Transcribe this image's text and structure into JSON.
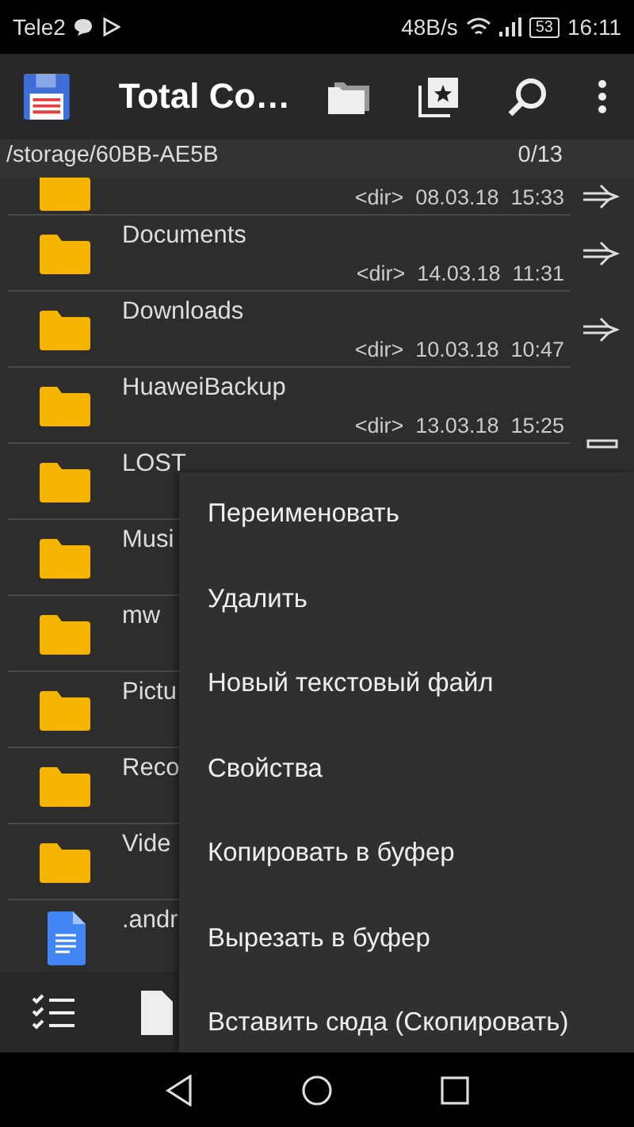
{
  "status_bar": {
    "carrier": "Tele2",
    "speed": "48B/s",
    "battery": "53",
    "time": "16:11"
  },
  "toolbar": {
    "title": "Total Co…"
  },
  "path_bar": {
    "path": "/storage/60BB-AE5B",
    "count": "0/13"
  },
  "files": [
    {
      "kind": "folder",
      "info": "<dir>  08.03.18  15:33",
      "arrow": true,
      "partial": true
    },
    {
      "kind": "folder",
      "name": "Documents",
      "info": "<dir>  14.03.18  11:31",
      "arrow": true
    },
    {
      "kind": "folder",
      "name": "Downloads",
      "info": "<dir>  10.03.18  10:47",
      "arrow": true
    },
    {
      "kind": "folder",
      "name": "HuaweiBackup",
      "info": "<dir>  13.03.18  15:25",
      "bar": true
    },
    {
      "kind": "folder",
      "name": "LOST"
    },
    {
      "kind": "folder",
      "name": "Musi"
    },
    {
      "kind": "folder",
      "name": "mw"
    },
    {
      "kind": "folder",
      "name": "Pictu"
    },
    {
      "kind": "folder",
      "name": "Reco"
    },
    {
      "kind": "folder",
      "name": "Vide"
    },
    {
      "kind": "document",
      "name": ".andr"
    }
  ],
  "context_menu": [
    "Переименовать",
    "Удалить",
    "Новый текстовый файл",
    "Свойства",
    "Копировать в буфер",
    "Вырезать в буфер",
    "Вставить сюда (Скопировать)"
  ]
}
